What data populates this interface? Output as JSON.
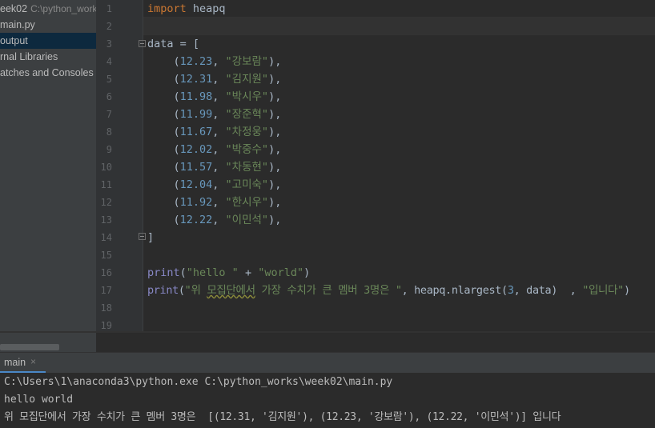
{
  "project": {
    "root_name": "eek02",
    "root_path": "C:\\python_work",
    "items": [
      "main.py",
      "output",
      "rnal Libraries",
      "atches and Consoles"
    ],
    "selected": "output"
  },
  "editor": {
    "line_numbers": [
      "1",
      "2",
      "3",
      "4",
      "5",
      "6",
      "7",
      "8",
      "9",
      "10",
      "11",
      "12",
      "13",
      "14",
      "15",
      "16",
      "17",
      "18",
      "19"
    ],
    "import_kw": "import",
    "import_mod": " heapq",
    "data_open": "data = [",
    "close_bracket": "]",
    "rows": [
      {
        "num": "12.23",
        "name": "\"강보람\""
      },
      {
        "num": "12.31",
        "name": "\"김지원\""
      },
      {
        "num": "11.98",
        "name": "\"박시우\""
      },
      {
        "num": "11.99",
        "name": "\"장준혁\""
      },
      {
        "num": "11.67",
        "name": "\"차정웅\""
      },
      {
        "num": "12.02",
        "name": "\"박중수\""
      },
      {
        "num": "11.57",
        "name": "\"차동현\""
      },
      {
        "num": "12.04",
        "name": "\"고미숙\""
      },
      {
        "num": "11.92",
        "name": "\"한시우\""
      },
      {
        "num": "12.22",
        "name": "\"이민석\""
      }
    ],
    "print1": {
      "fn": "print",
      "s1": "\"hello \"",
      "op": " + ",
      "s2": "\"world\""
    },
    "print2": {
      "fn": "print",
      "s1a": "\"위 ",
      "s1warn": "모집단에서",
      "s1b": " 가장 수치가 큰 멤버 3명은 \"",
      "call": ", heapq.nlargest(",
      "n": "3",
      "arg": ", data)",
      "s2": "\"입니다\""
    },
    "hint": "_,"
  },
  "run": {
    "tab_label": "main",
    "close_glyph": "×",
    "lines": [
      "C:\\Users\\1\\anaconda3\\python.exe C:\\python_works\\week02\\main.py",
      "hello world",
      "위 모집단에서 가장 수치가 큰 멤버 3명은  [(12.31, '김지원'), (12.23, '강보람'), (12.22, '이민석')] 입니다"
    ]
  },
  "colors": {
    "keyword": "#cc7832",
    "string": "#6a8759",
    "number": "#6897bb",
    "builtin": "#8888c6",
    "text": "#a9b7c6",
    "selection": "#0d293e"
  }
}
